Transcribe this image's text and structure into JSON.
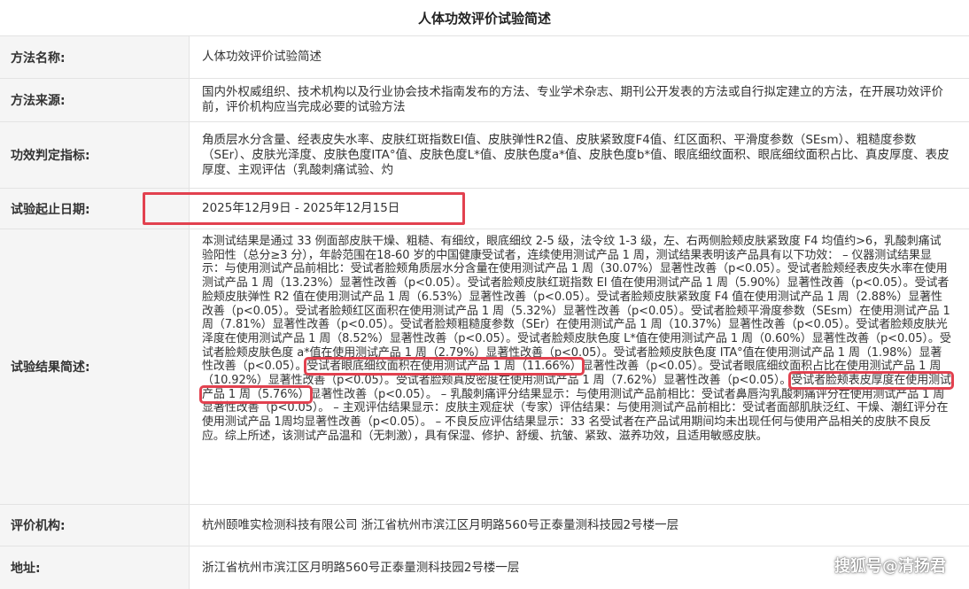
{
  "title": "人体功效评价试验简述",
  "rows": [
    {
      "label": "方法名称:",
      "value": "人体功效评价试验简述"
    },
    {
      "label": "方法来源:",
      "value": "国内外权威组织、技术机构以及行业协会技术指南发布的方法、专业学术杂志、期刊公开发表的方法或自行拟定建立的方法，在开展功效评价前，评价机构应当完成必要的试验方法"
    },
    {
      "label": "功效判定指标:",
      "value": "角质层水分含量、经表皮失水率、皮肤红斑指数EI值、皮肤弹性R2值、皮肤紧致度F4值、红区面积、平滑度参数（SEsm）、粗糙度参数（SEr）、皮肤光泽度、皮肤色度ITA°值、皮肤色度L*值、皮肤色度a*值、皮肤色度b*值、眼底细纹面积、眼底细纹面积占比、真皮厚度、表皮厚度、主观评估（乳酸刺痛试验、灼"
    },
    {
      "label": "试验起止日期:",
      "value": "2025年12月9日 - 2025年12月15日"
    },
    {
      "label": "试验结果简述:",
      "value_parts": [
        "本测试结果是通过 33 例面部皮肤干燥、粗糙、有细纹，眼底细纹 2-5 级，法令纹 1-3 级，左、右两侧脸颊皮肤紧致度 F4 均值约>6，乳酸刺痛试验阳性（总分≥3 分），年龄范围在18-60 岁的中国健康受试者，连续使用测试产品 1 周，测试结果表明该产品具有以下功效： – 仪器测试结果显示：与使用测试产品前相比：受试者脸颊角质层水分含量在使用测试产品 1 周（30.07%）显著性改善（p<0.05）。受试者脸颊经表皮失水率在使用测试产品 1 周（13.23%）显著性改善（p<0.05）。受试者脸颊皮肤红斑指数 EI 值在使用测试产品 1 周（5.90%）显著性改善（p<0.05）。受试者脸颊皮肤弹性 R2 值在使用测试产品 1 周（6.53%）显著性改善（p<0.05）。受试者脸颊皮肤紧致度 F4 值在使用测试产品 1 周（2.88%）显著性改善（p<0.05）。受试者脸颊红区面积在使用测试产品 1 周（5.32%）显著性改善（p<0.05）。受试者脸颊平滑度参数（SEsm）在使用测试产品 1 周（7.81%）显著性改善（p<0.05）。受试者脸颊粗糙度参数（SEr）在使用测试产品 1 周（10.37%）显著性改善（p<0.05）。受试者脸颊皮肤光泽度在使用测试产品 1 周（8.52%）显著性改善（p<0.05）。受试者脸颊皮肤色度 L*值在使用测试产品 1 周（0.60%）显著性改善（p<0.05）。受试者脸颊皮肤色度 a*值在使用测试产品 1 周（2.79%）显著性改善（p<0.05）。受试者脸颊皮肤色度 ITA°值在使用测试产品 1 周（1.98%）显著性改善（p<0.05）。",
        "受试者眼底细纹面积在使用测试产品 1 周（11.66%）",
        "显著性改善（p<0.05）。受试者眼底细纹面积占比在使用测试产品 1 周（10.92%）显著性改善（p<0.05）。受试者脸颊真皮密度在使用测试产品 1 周（7.62%）显著性改善（p<0.05）。",
        "受试者脸颊表皮厚度在使用测试产品 1 周（5.76%）",
        "显著性改善（p<0.05）。 – 乳酸刺痛评分结果显示：与使用测试产品前相比：受试者鼻唇沟乳酸刺痛评分在使用测试产品 1 周显著性改善（p<0.05）。 – 主观评估结果显示：皮肤主观症状（专家）评估结果：与使用测试产品前相比：受试者面部肌肤泛红、干燥、潮红评分在使用测试产品 1周均显著性改善（p<0.05）。 – 不良反应评估结果显示：33 名受试者在产品试用期间均未出现任何与使用产品相关的皮肤不良反应。综上所述，该测试产品温和（无刺激），具有保湿、修护、舒缓、抗皱、紧致、滋养功效，且适用敏感皮肤。"
      ]
    },
    {
      "label": "评价机构:",
      "value": "杭州颐唯实检测科技有限公司 浙江省杭州市滨江区月明路560号正泰量测科技园2号楼一层"
    },
    {
      "label": "地址:",
      "value": "浙江省杭州市滨江区月明路560号正泰量测科技园2号楼一层"
    }
  ],
  "watermark": "搜狐号@清扬君",
  "colors": {
    "highlight": "#e2414f",
    "label_bg": "#f5f5f5",
    "border": "#e3e3e3"
  }
}
